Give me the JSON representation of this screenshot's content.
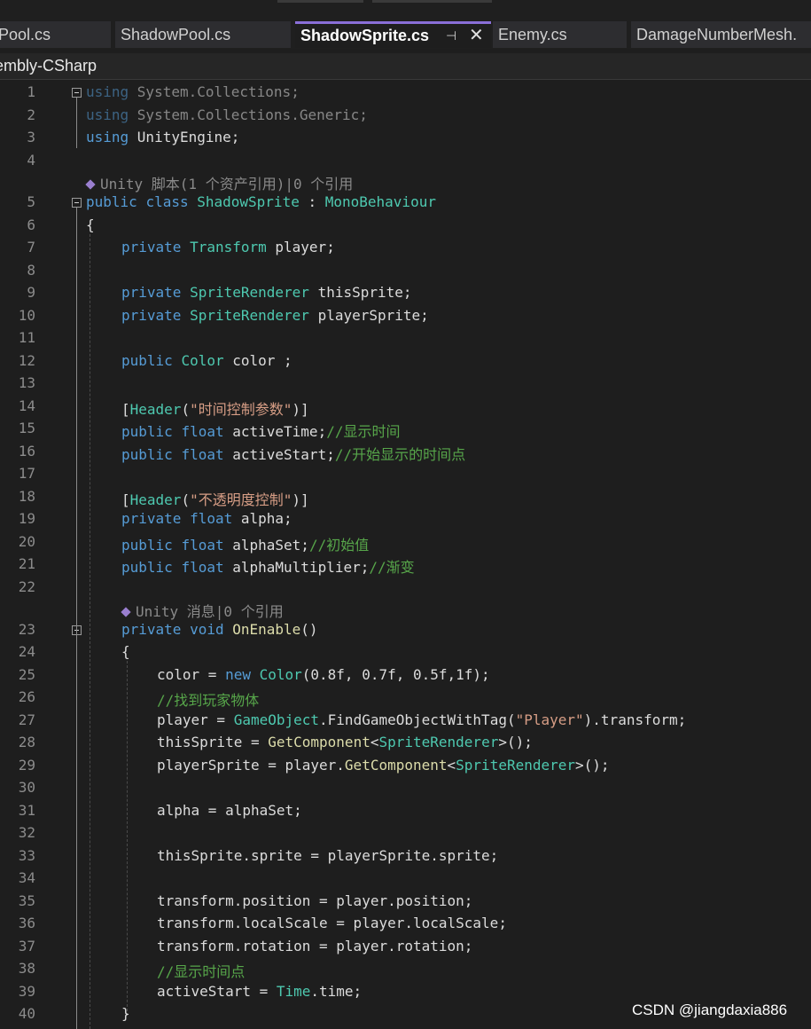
{
  "tabs": [
    {
      "label": "Pool.cs"
    },
    {
      "label": "ShadowPool.cs"
    },
    {
      "label": "ShadowSprite.cs"
    },
    {
      "label": "Enemy.cs"
    },
    {
      "label": "DamageNumberMesh."
    }
  ],
  "tab_icons": {
    "pin": "⊣",
    "close": "✕"
  },
  "navbar": {
    "project": "embly-CSharp"
  },
  "codelens": {
    "class": "Unity 脚本(1 个资产引用)|0 个引用",
    "method": "Unity 消息|0 个引用"
  },
  "watermark": "CSDN @jiangdaxia886",
  "colors": {
    "background": "#1e1e1e",
    "keyword": "#569cd6",
    "type": "#4ec9b0",
    "comment": "#57a64a",
    "string": "#d69d85",
    "active_tab_accent": "#8a6fd8"
  },
  "lines": [
    {
      "n": "1",
      "t": [
        [
          "kw",
          "using"
        ],
        [
          "",
          "System.Collections;"
        ]
      ]
    },
    {
      "n": "2",
      "t": [
        [
          "kw",
          "using"
        ],
        [
          "",
          "System.Collections.Generic;"
        ]
      ]
    },
    {
      "n": "3",
      "t": [
        [
          "kw",
          "using"
        ],
        [
          "",
          "UnityEngine;"
        ]
      ]
    },
    {
      "n": "4",
      "t": []
    },
    {
      "n": "5",
      "t": [
        [
          "kw",
          "public"
        ],
        [
          "kw",
          "class"
        ],
        [
          "ty",
          "ShadowSprite"
        ],
        [
          "",
          ":"
        ],
        [
          "ty",
          "MonoBehaviour"
        ]
      ]
    },
    {
      "n": "6",
      "t": [
        [
          "",
          "{"
        ]
      ]
    },
    {
      "n": "7",
      "t": [
        [
          "kw",
          "private"
        ],
        [
          "ty",
          "Transform"
        ],
        [
          "",
          "player;"
        ]
      ]
    },
    {
      "n": "8",
      "t": []
    },
    {
      "n": "9",
      "t": [
        [
          "kw",
          "private"
        ],
        [
          "ty",
          "SpriteRenderer"
        ],
        [
          "",
          "thisSprite;"
        ]
      ]
    },
    {
      "n": "10",
      "t": [
        [
          "kw",
          "private"
        ],
        [
          "ty",
          "SpriteRenderer"
        ],
        [
          "",
          "playerSprite;"
        ]
      ]
    },
    {
      "n": "11",
      "t": []
    },
    {
      "n": "12",
      "t": [
        [
          "kw",
          "public"
        ],
        [
          "ty",
          "Color"
        ],
        [
          "",
          "color ;"
        ]
      ]
    },
    {
      "n": "13",
      "t": []
    },
    {
      "n": "14",
      "t": [
        [
          "",
          "["
        ],
        [
          "ty",
          "Header"
        ],
        [
          "",
          "("
        ],
        [
          "st",
          "\"时间控制参数\""
        ],
        [
          "",
          ")]"
        ]
      ]
    },
    {
      "n": "15",
      "t": [
        [
          "kw",
          "public"
        ],
        [
          "kw",
          "float"
        ],
        [
          "",
          "activeTime;"
        ],
        [
          "cm",
          "//显示时间"
        ]
      ]
    },
    {
      "n": "16",
      "t": [
        [
          "kw",
          "public"
        ],
        [
          "kw",
          "float"
        ],
        [
          "",
          "activeStart;"
        ],
        [
          "cm",
          "//开始显示的时间点"
        ]
      ]
    },
    {
      "n": "17",
      "t": []
    },
    {
      "n": "18",
      "t": [
        [
          "",
          "["
        ],
        [
          "ty",
          "Header"
        ],
        [
          "",
          "("
        ],
        [
          "st",
          "\"不透明度控制\""
        ],
        [
          "",
          ")]"
        ]
      ]
    },
    {
      "n": "19",
      "t": [
        [
          "kw",
          "private"
        ],
        [
          "kw",
          "float"
        ],
        [
          "",
          "alpha;"
        ]
      ]
    },
    {
      "n": "20",
      "t": [
        [
          "kw",
          "public"
        ],
        [
          "kw",
          "float"
        ],
        [
          "",
          "alphaSet;"
        ],
        [
          "cm",
          "//初始值"
        ]
      ]
    },
    {
      "n": "21",
      "t": [
        [
          "kw",
          "public"
        ],
        [
          "kw",
          "float"
        ],
        [
          "",
          "alphaMultiplier;"
        ],
        [
          "cm",
          "//渐变"
        ]
      ]
    },
    {
      "n": "22",
      "t": []
    },
    {
      "n": "23",
      "t": [
        [
          "kw",
          "private"
        ],
        [
          "kw",
          "void"
        ],
        [
          "fn",
          "OnEnable"
        ],
        [
          "",
          "()"
        ]
      ]
    },
    {
      "n": "24",
      "t": [
        [
          "",
          "{"
        ]
      ]
    },
    {
      "n": "25",
      "t": [
        [
          "",
          "color ="
        ],
        [
          "kw",
          "new"
        ],
        [
          "ty",
          "Color"
        ],
        [
          "",
          "(0.8f, 0.7f, 0.5f,1f);"
        ]
      ]
    },
    {
      "n": "26",
      "t": [
        [
          "cm",
          "//找到玩家物体"
        ]
      ]
    },
    {
      "n": "27",
      "t": [
        [
          "",
          "player ="
        ],
        [
          "ty",
          "GameObject"
        ],
        [
          "",
          ".FindGameObjectWithTag("
        ],
        [
          "st",
          "\"Player\""
        ],
        [
          "",
          ").transform;"
        ]
      ]
    },
    {
      "n": "28",
      "t": [
        [
          "",
          "thisSprite ="
        ],
        [
          "fn",
          "GetComponent"
        ],
        [
          "",
          "<"
        ],
        [
          "ty",
          "SpriteRenderer"
        ],
        [
          "",
          ">();"
        ]
      ]
    },
    {
      "n": "29",
      "t": [
        [
          "",
          "playerSprite = player."
        ],
        [
          "fn",
          "GetComponent"
        ],
        [
          "",
          "<"
        ],
        [
          "ty",
          "SpriteRenderer"
        ],
        [
          "",
          ">();"
        ]
      ]
    },
    {
      "n": "30",
      "t": []
    },
    {
      "n": "31",
      "t": [
        [
          "",
          "alpha = alphaSet;"
        ]
      ]
    },
    {
      "n": "32",
      "t": []
    },
    {
      "n": "33",
      "t": [
        [
          "",
          "thisSprite.sprite = playerSprite.sprite;"
        ]
      ]
    },
    {
      "n": "34",
      "t": []
    },
    {
      "n": "35",
      "t": [
        [
          "",
          "transform.position = player.position;"
        ]
      ]
    },
    {
      "n": "36",
      "t": [
        [
          "",
          "transform.localScale = player.localScale;"
        ]
      ]
    },
    {
      "n": "37",
      "t": [
        [
          "",
          "transform.rotation = player.rotation;"
        ]
      ]
    },
    {
      "n": "38",
      "t": [
        [
          "cm",
          "//显示时间点"
        ]
      ]
    },
    {
      "n": "39",
      "t": [
        [
          "",
          "activeStart ="
        ],
        [
          "ty",
          "Time"
        ],
        [
          "",
          ".time;"
        ]
      ]
    },
    {
      "n": "40",
      "t": [
        [
          "",
          "}"
        ]
      ]
    }
  ]
}
